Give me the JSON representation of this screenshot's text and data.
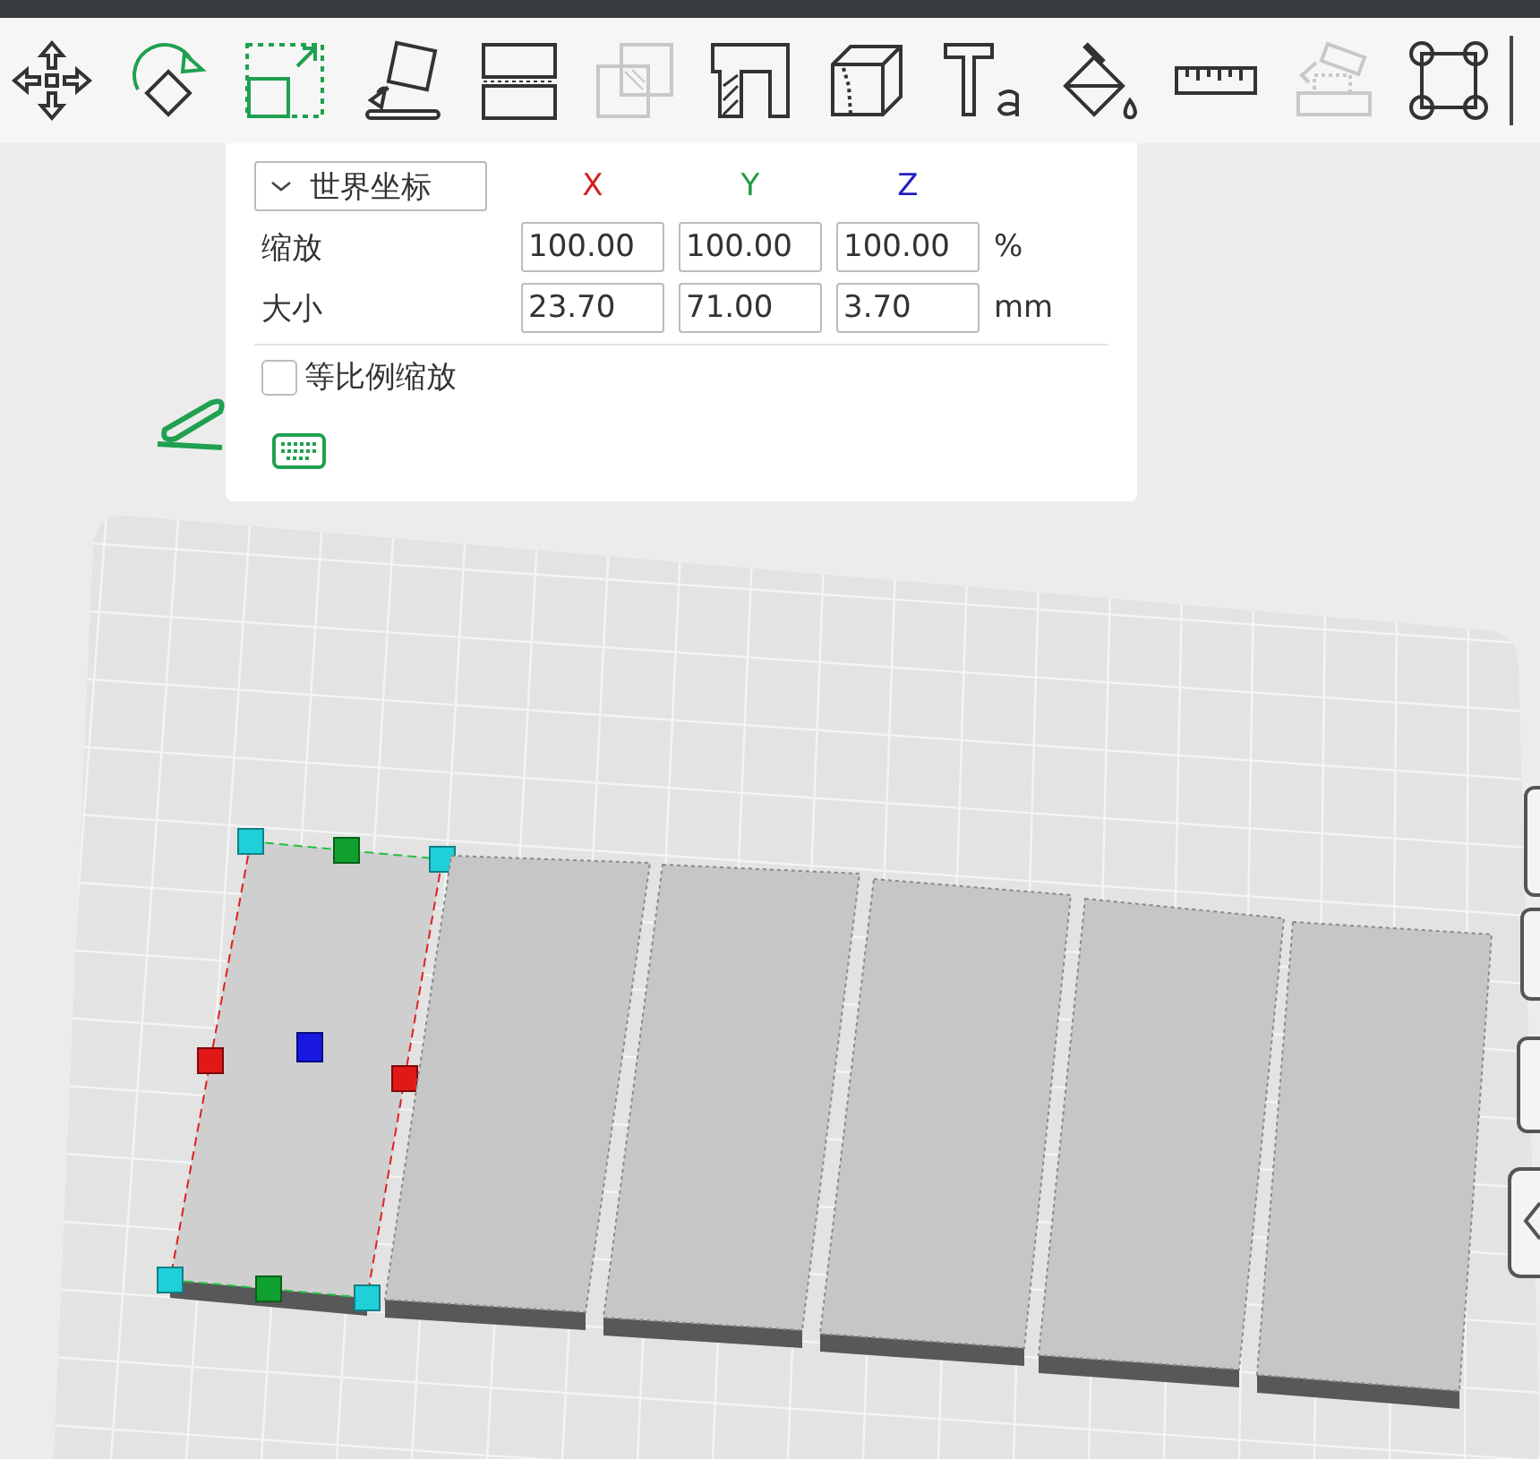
{
  "toolbar": {
    "tools": [
      {
        "selected": false,
        "disabled": false
      },
      {
        "selected": false,
        "disabled": false
      },
      {
        "selected": true,
        "disabled": false
      },
      {
        "selected": false,
        "disabled": false
      },
      {
        "selected": false,
        "disabled": false
      },
      {
        "selected": false,
        "disabled": true
      },
      {
        "selected": false,
        "disabled": false
      },
      {
        "selected": false,
        "disabled": false
      },
      {
        "selected": false,
        "disabled": false
      },
      {
        "selected": false,
        "disabled": false
      },
      {
        "selected": false,
        "disabled": false
      },
      {
        "selected": false,
        "disabled": true
      },
      {
        "selected": false,
        "disabled": false
      }
    ]
  },
  "scale_panel": {
    "coordinate_dropdown": "世界坐标",
    "axes": [
      {
        "label": "X",
        "color": "#d42020"
      },
      {
        "label": "Y",
        "color": "#1e9a40"
      },
      {
        "label": "Z",
        "color": "#2020c0"
      }
    ],
    "rows": [
      {
        "label": "缩放",
        "values": [
          "100.00",
          "100.00",
          "100.00"
        ],
        "unit": "%"
      },
      {
        "label": "大小",
        "values": [
          "23.70",
          "71.00",
          "3.70"
        ],
        "unit": "mm"
      }
    ],
    "uniform_scale": {
      "label": "等比例缩放",
      "checked": false
    }
  },
  "objects": [
    {
      "selected": true
    },
    {
      "selected": false
    },
    {
      "selected": false
    },
    {
      "selected": false
    },
    {
      "selected": false
    },
    {
      "selected": false
    }
  ]
}
